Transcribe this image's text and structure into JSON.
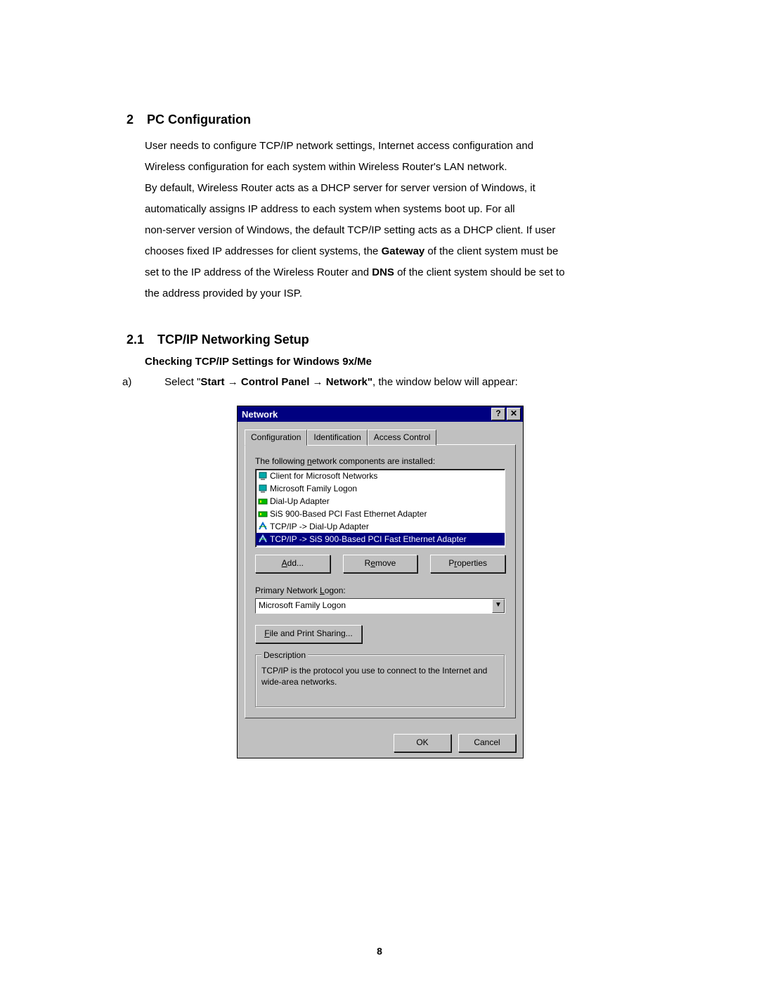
{
  "section": {
    "number": "2",
    "title": "PC Configuration",
    "paragraph_lines": [
      "User needs to configure TCP/IP network settings, Internet access configuration and",
      "Wireless configuration for each system within Wireless Router's LAN network.",
      "By default, Wireless Router acts as a DHCP server for server version of Windows, it",
      "automatically assigns IP address to each system when systems boot up.    For all",
      "non-server version of Windows, the default TCP/IP setting acts as a DHCP client.    If user",
      "chooses fixed IP addresses for client systems, the "
    ],
    "bold_gateway": "Gateway",
    "after_gateway": " of the client system must be",
    "line7a": "set to the IP address of the Wireless Router and ",
    "bold_dns": "DNS",
    "after_dns": " of the client system should be set to",
    "line8": "the address provided by your ISP."
  },
  "subsection": {
    "number": "2.1",
    "title": "TCP/IP Networking Setup",
    "subheading": "Checking TCP/IP Settings for Windows 9x/Me",
    "item_marker": "a)",
    "item_pre": "Select \"",
    "item_bold": "Start → Control Panel → Network\"",
    "item_post": ", the window below will appear:"
  },
  "dialog": {
    "title": "Network",
    "help_btn": "?",
    "close_btn": "✕",
    "tabs": [
      "Configuration",
      "Identification",
      "Access Control"
    ],
    "active_tab_index": 0,
    "installed_label_pre": "The following ",
    "installed_label_u": "n",
    "installed_label_post": "etwork components are installed:",
    "list_items": [
      {
        "icon": "client-icon",
        "text": "Client for Microsoft Networks",
        "selected": false
      },
      {
        "icon": "client-icon",
        "text": "Microsoft Family Logon",
        "selected": false
      },
      {
        "icon": "adapter-icon",
        "text": "Dial-Up Adapter",
        "selected": false
      },
      {
        "icon": "adapter-icon",
        "text": "SiS 900-Based PCI Fast Ethernet Adapter",
        "selected": false
      },
      {
        "icon": "protocol-icon",
        "text": "TCP/IP -> Dial-Up Adapter",
        "selected": false
      },
      {
        "icon": "protocol-icon",
        "text": "TCP/IP -> SiS 900-Based PCI Fast Ethernet Adapter",
        "selected": true
      }
    ],
    "add_pre": "",
    "add_u": "A",
    "add_post": "dd...",
    "remove_pre": "R",
    "remove_u": "e",
    "remove_post": "move",
    "props_pre": "P",
    "props_u": "r",
    "props_post": "operties",
    "primary_label_pre": "Primary Network ",
    "primary_label_u": "L",
    "primary_label_post": "ogon:",
    "primary_value": "Microsoft Family Logon",
    "fps_pre": "",
    "fps_u": "F",
    "fps_post": "ile and Print Sharing...",
    "description_legend": "Description",
    "description_text": "TCP/IP is the protocol you use to connect to the Internet and wide-area networks.",
    "ok": "OK",
    "cancel": "Cancel"
  },
  "page_number": "8"
}
